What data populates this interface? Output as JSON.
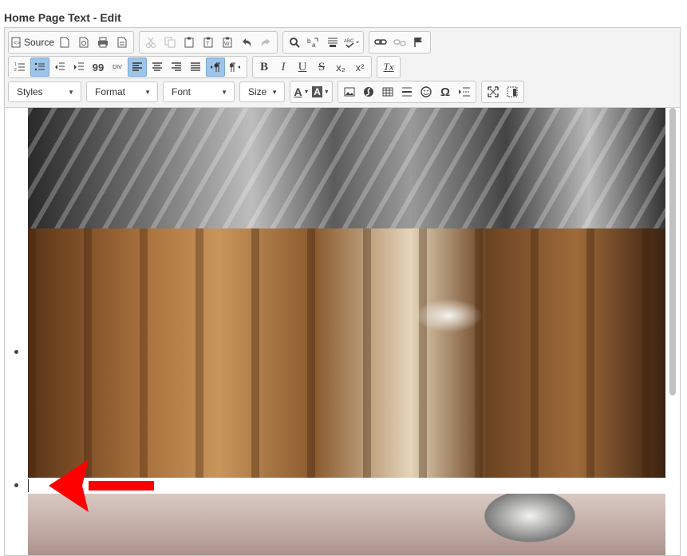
{
  "page": {
    "title": "Home Page Text - Edit"
  },
  "toolbar": {
    "source_label": "Source",
    "combos": {
      "styles": "Styles",
      "format": "Format",
      "font": "Font",
      "size": "Size"
    },
    "glyphs": {
      "quote": "99",
      "div": "DIV",
      "bold": "B",
      "italic": "I",
      "underline": "U",
      "strike": "S",
      "subscript": "x₂",
      "superscript": "x²",
      "remove_format": "Tx",
      "text_color": "A",
      "bg_color": "A",
      "special_char": "Ω"
    }
  },
  "colors": {
    "active_button": "#9ec4e8",
    "arrow": "#ff0000"
  },
  "content": {
    "images": [
      "architecture-photo",
      "barrel-warehouse-photo",
      "lighthouse-photo"
    ]
  }
}
